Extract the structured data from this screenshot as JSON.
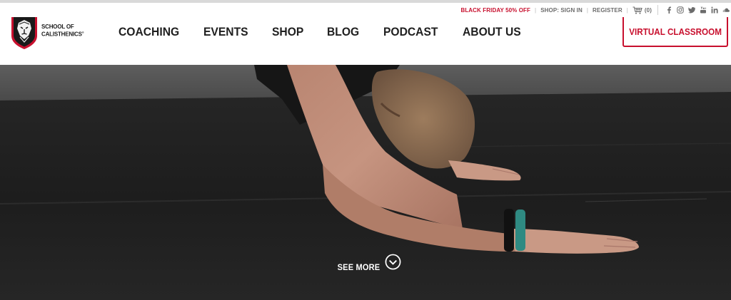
{
  "utility": {
    "promo": "BLACK FRIDAY 50% OFF",
    "sep": "|",
    "sign_in": "SHOP: SIGN IN",
    "register": "REGISTER",
    "cart_count": "(0)",
    "social_icons": [
      "facebook-icon",
      "instagram-icon",
      "twitter-icon",
      "youtube-icon",
      "linkedin-icon",
      "soundcloud-icon"
    ]
  },
  "logo": {
    "line1": "SCHOOL OF",
    "line2": "CALISTHENICS"
  },
  "nav": {
    "items": [
      "COACHING",
      "EVENTS",
      "SHOP",
      "BLOG",
      "PODCAST",
      "ABOUT US"
    ]
  },
  "cta": {
    "label": "VIRTUAL CLASSROOM"
  },
  "hero": {
    "see_more": "SEE MORE"
  },
  "colors": {
    "accent": "#c8102e",
    "text": "#1f1f1f",
    "muted": "#6b6b6b",
    "hero_floor": "#1a1a1a"
  }
}
